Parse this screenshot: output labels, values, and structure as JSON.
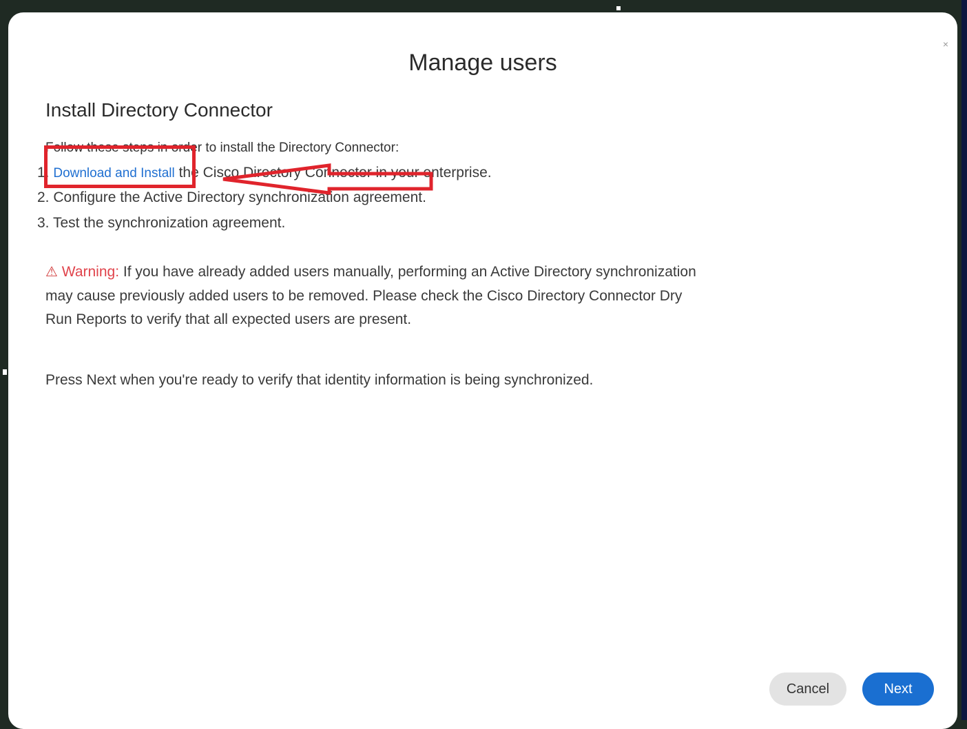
{
  "dialog": {
    "title": "Manage users",
    "close_glyph": "×",
    "section_title": "Install Directory Connector",
    "intro": "Follow these steps in order to install the Directory Connector:",
    "steps": [
      {
        "number": "1.",
        "link": "Download and Install",
        "text": " the Cisco Directory Connector in your enterprise."
      },
      {
        "number": "2.",
        "text": " Configure the Active Directory synchronization agreement."
      },
      {
        "number": "3.",
        "text": " Test the synchronization agreement."
      }
    ],
    "warning": {
      "icon": "warning-triangle-icon",
      "icon_glyph": "⚠",
      "label": "Warning:",
      "text": " If you have already added users manually, performing an Active Directory synchronization may cause previously added users to be removed. Please check the Cisco Directory Connector Dry Run Reports to verify that all expected users are present."
    },
    "press_next": "Press Next when you're ready to verify that identity information is being synchronized.",
    "buttons": {
      "cancel": "Cancel",
      "next": "Next"
    }
  },
  "colors": {
    "link": "#1f6fd1",
    "warning": "#e0434b",
    "primary_button": "#1a6fd1",
    "annotation": "#e0242c"
  }
}
